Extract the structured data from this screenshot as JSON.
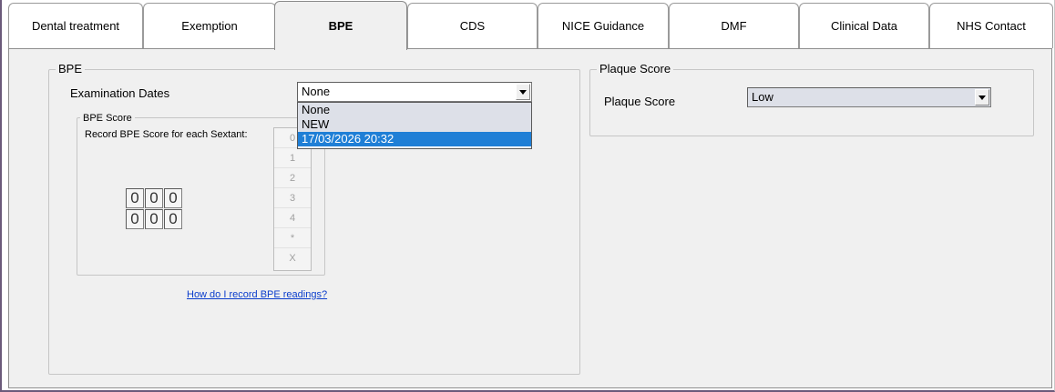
{
  "tabs": [
    {
      "label": "Dental treatment"
    },
    {
      "label": "Exemption"
    },
    {
      "label": "BPE"
    },
    {
      "label": "CDS"
    },
    {
      "label": "NICE Guidance"
    },
    {
      "label": "DMF"
    },
    {
      "label": "Clinical Data"
    },
    {
      "label": "NHS Contact"
    }
  ],
  "bpe": {
    "group_title": "BPE",
    "exam_label": "Examination Dates",
    "exam_value": "None",
    "exam_options": [
      "None",
      "NEW",
      "17/03/2026 20:32"
    ],
    "exam_selected_option": "17/03/2026 20:32",
    "score_group_title": "BPE Score",
    "record_label": "Record BPE Score for each Sextant:",
    "sextants": [
      "0",
      "0",
      "0",
      "0",
      "0",
      "0"
    ],
    "keypad": [
      "0",
      "1",
      "2",
      "3",
      "4",
      "*",
      "X"
    ],
    "help_link": "How do I record BPE readings?"
  },
  "plaque": {
    "group_title": "Plaque Score",
    "label": "Plaque Score",
    "value": "Low"
  }
}
